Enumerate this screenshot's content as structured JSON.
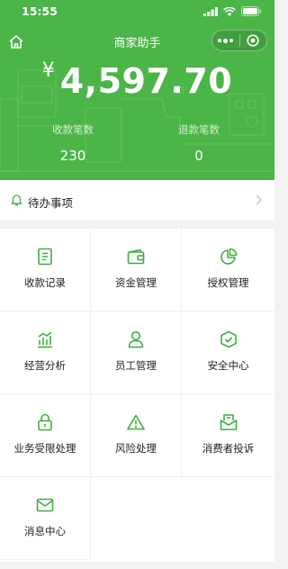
{
  "status_bar": {
    "time": "15:55"
  },
  "navbar": {
    "title": "商家助手"
  },
  "summary": {
    "currency_symbol": "¥",
    "balance": "4,597.70",
    "stats": [
      {
        "label": "收款笔数",
        "value": "230"
      },
      {
        "label": "退款笔数",
        "value": "0"
      }
    ]
  },
  "todo": {
    "label": "待办事项"
  },
  "menu": [
    {
      "label": "收款记录",
      "icon": "receipt-icon"
    },
    {
      "label": "资金管理",
      "icon": "wallet-icon"
    },
    {
      "label": "授权管理",
      "icon": "pie-chart-icon"
    },
    {
      "label": "经营分析",
      "icon": "bar-chart-icon"
    },
    {
      "label": "员工管理",
      "icon": "person-icon"
    },
    {
      "label": "安全中心",
      "icon": "shield-icon"
    },
    {
      "label": "业务受限处理",
      "icon": "lock-icon"
    },
    {
      "label": "风险处理",
      "icon": "warning-icon"
    },
    {
      "label": "消费者投诉",
      "icon": "complaint-mail-icon"
    },
    {
      "label": "消息中心",
      "icon": "mail-icon"
    }
  ],
  "colors": {
    "brand": "#4cb548",
    "icon": "#3fae3f",
    "background": "#f2f2f2"
  }
}
